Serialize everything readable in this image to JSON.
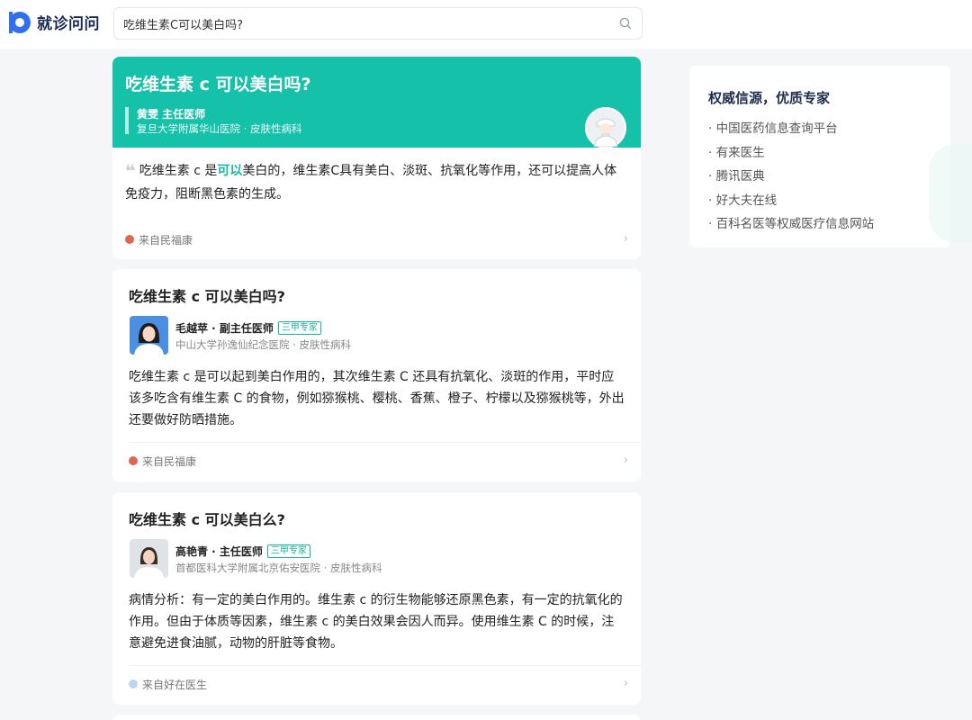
{
  "header": {
    "logo_text": "就诊问问",
    "search": {
      "value": "吃维生素C可以美白吗?",
      "placeholder": ""
    }
  },
  "cards": [
    {
      "title": "吃维生素 c 可以美白吗?",
      "doctor_name": "黄雯 主任医师",
      "hospital": "复旦大学附属华山医院 · 皮肤性病科",
      "answer_before": "吃维生素 c 是",
      "answer_highlight": "可以",
      "answer_after": "美白的，维生素C具有美白、淡斑、抗氧化等作用，还可以提高人体免疫力，阻断黑色素的生成。",
      "source": "来自民福康"
    },
    {
      "title": "吃维生素 c 可以美白吗?",
      "doctor_name": "毛越苹 · 副主任医师",
      "badge": "三甲专家",
      "hospital": "中山大学孙逸仙纪念医院 · 皮肤性病科",
      "answer": "吃维生素 c 是可以起到美白作用的，其次维生素 C 还具有抗氧化、淡斑的作用，平时应该多吃含有维生素 C 的食物，例如猕猴桃、樱桃、香蕉、橙子、柠檬以及猕猴桃等，外出还要做好防晒措施。",
      "source": "来自民福康"
    },
    {
      "title": "吃维生素 c 可以美白么?",
      "doctor_name": "高艳青 · 主任医师",
      "badge": "三甲专家",
      "hospital": "首都医科大学附属北京佑安医院 · 皮肤性病科",
      "answer": "病情分析：有一定的美白作用的。维生素 c 的衍生物能够还原黑色素，有一定的抗氧化的作用。但由于体质等因素，维生素 c 的美白效果会因人而异。使用维生素 C 的时候，注意避免进食油腻，动物的肝脏等食物。",
      "source": "来自好在医生"
    }
  ],
  "sidebar": {
    "title": "权威信源，优质专家",
    "items": [
      "· 中国医药信息查询平台",
      "· 有来医生",
      "· 腾讯医典",
      "· 好大夫在线",
      "· 百科名医等权威医疗信息网站"
    ]
  },
  "icons": {
    "search": "search-icon",
    "chevron": "chevron-right-icon",
    "quote": "quote-icon"
  },
  "colors": {
    "accent": "#15c1a9",
    "brand": "#2f6ff0"
  }
}
